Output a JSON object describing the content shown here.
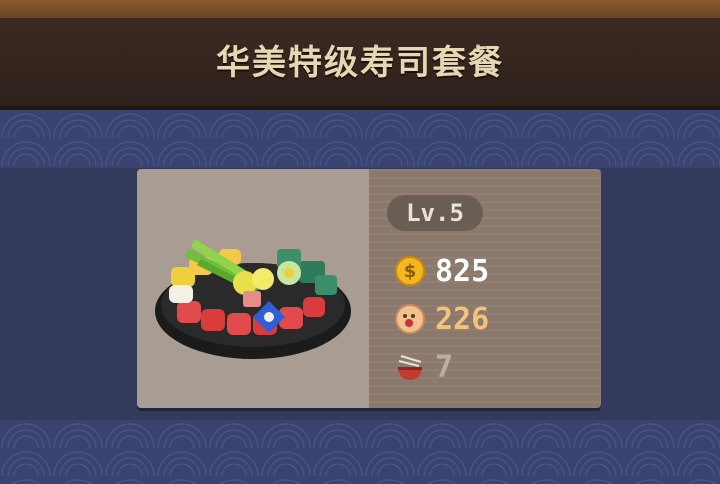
{
  "header": {
    "title": "华美特级寿司套餐"
  },
  "item": {
    "image_icon": "sushi-platter-icon",
    "level": "Lv.5",
    "stats": {
      "coins": {
        "icon": "coin-icon",
        "value": "825",
        "color": "#ffffff"
      },
      "satisfaction": {
        "icon": "face-icon",
        "value": "226",
        "color": "#f4c27a"
      },
      "servings": {
        "icon": "bowl-chopsticks-icon",
        "value": "7",
        "color": "#b9aea4"
      }
    }
  },
  "colors": {
    "title_bar": "#2e211b",
    "background": "#343a5c",
    "card_left": "#a99d93",
    "card_right": "#8b7a6c"
  }
}
